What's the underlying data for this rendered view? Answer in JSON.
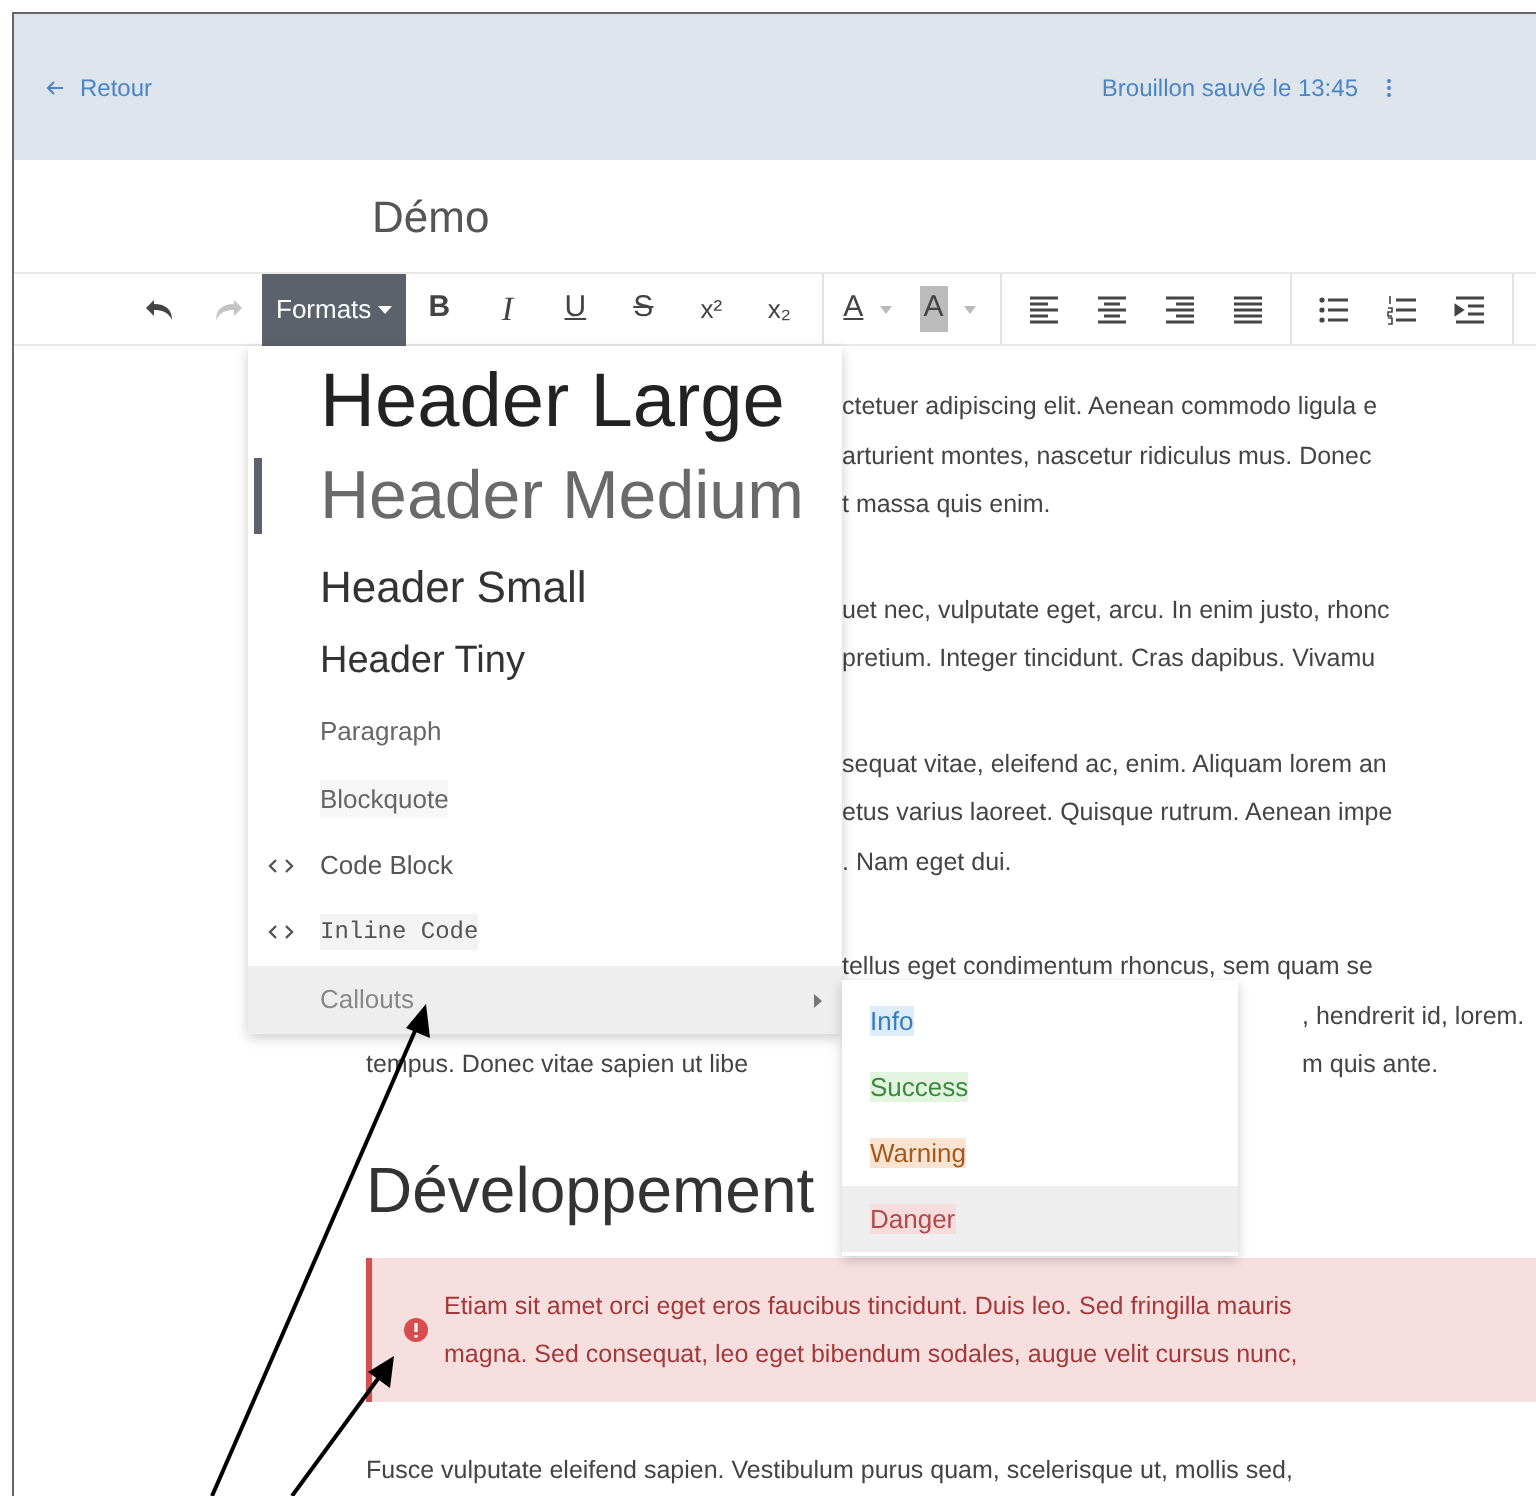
{
  "topbar": {
    "back_link": "Retour",
    "status": "Brouillon sauvé le 13:45"
  },
  "document_title": "Démo",
  "toolbar": {
    "groups": [
      [
        {
          "kind": "undo",
          "disabled": false
        },
        {
          "kind": "redo",
          "disabled": true
        },
        {
          "kind": "dropdown",
          "label": "Formats",
          "expanded": true
        },
        {
          "kind": "bold",
          "label": "B"
        },
        {
          "kind": "italic",
          "label": "I"
        },
        {
          "kind": "underline",
          "label": "U"
        },
        {
          "kind": "strike",
          "label": "S"
        },
        {
          "kind": "sup",
          "label": "x²"
        },
        {
          "kind": "sub",
          "label": "x₂"
        }
      ],
      [
        {
          "kind": "color",
          "label": "A"
        },
        {
          "kind": "highlight",
          "label": "A"
        }
      ],
      [
        {
          "kind": "align-left"
        },
        {
          "kind": "align-center"
        },
        {
          "kind": "align-right"
        },
        {
          "kind": "justify"
        }
      ],
      [
        {
          "kind": "bullets"
        },
        {
          "kind": "numbers"
        },
        {
          "kind": "indent"
        }
      ]
    ]
  },
  "formats_menu": [
    {
      "label": "Header Large",
      "kind": "h1",
      "selected": false
    },
    {
      "label": "Header Medium",
      "kind": "h2",
      "selected": true
    },
    {
      "label": "Header Small",
      "kind": "h3",
      "selected": false
    },
    {
      "label": "Header Tiny",
      "kind": "h4",
      "selected": false
    },
    {
      "label": "Paragraph",
      "kind": "p",
      "selected": false
    },
    {
      "label": "Blockquote",
      "kind": "quote",
      "selected": false
    },
    {
      "label": "Code Block",
      "kind": "code",
      "selected": false
    },
    {
      "label": "Inline Code",
      "kind": "inline",
      "selected": false
    },
    {
      "label": "Callouts",
      "kind": "submenu",
      "selected": false,
      "expanded": true
    }
  ],
  "callouts_menu": [
    {
      "label": "Info",
      "kind": "info",
      "selected": false
    },
    {
      "label": "Success",
      "kind": "success",
      "selected": false
    },
    {
      "label": "Warning",
      "kind": "warning",
      "selected": false
    },
    {
      "label": "Danger",
      "kind": "danger",
      "selected": true
    }
  ],
  "document": [
    {
      "kind": "paragraph",
      "lines": [
        {
          "middle": "ctetuer adipiscing elit. Aenean commodo ligula e"
        },
        {
          "middle": "arturient montes, nascetur ridiculus mus. Donec"
        },
        {
          "middle": "t massa quis enim."
        }
      ]
    },
    {
      "kind": "paragraph",
      "lines": [
        {
          "middle": "uet nec, vulputate eget, arcu. In enim justo, rhonc"
        },
        {
          "middle": "pretium. Integer tincidunt. Cras dapibus. Vivamu"
        }
      ]
    },
    {
      "kind": "paragraph",
      "lines": [
        {
          "middle": "sequat vitae, eleifend ac, enim. Aliquam lorem an"
        },
        {
          "middle": "etus varius laoreet. Quisque rutrum. Aenean impe"
        },
        {
          "middle": ". Nam eget dui."
        }
      ]
    },
    {
      "kind": "paragraph",
      "lines": [
        {
          "middle": "tellus eget condimentum rhoncus, sem quam se"
        },
        {
          "right": ", hendrerit id, lorem."
        },
        {
          "left": "tempus. Donec vitae sapien ut libe",
          "right": "m quis ante."
        }
      ]
    },
    {
      "kind": "heading",
      "text": "Développement"
    },
    {
      "kind": "callout",
      "color": "#d64d4d",
      "lines": [
        "Etiam sit amet orci eget eros faucibus tincidunt. Duis leo. Sed fringilla mauris",
        "magna. Sed consequat, leo eget bibendum sodales, augue velit cursus nunc,"
      ]
    },
    {
      "kind": "paragraph",
      "lines": [
        {
          "left": "Fusce vulputate eleifend sapien. Vestibulum purus quam, scelerisque ut, mollis sed,"
        }
      ]
    }
  ]
}
